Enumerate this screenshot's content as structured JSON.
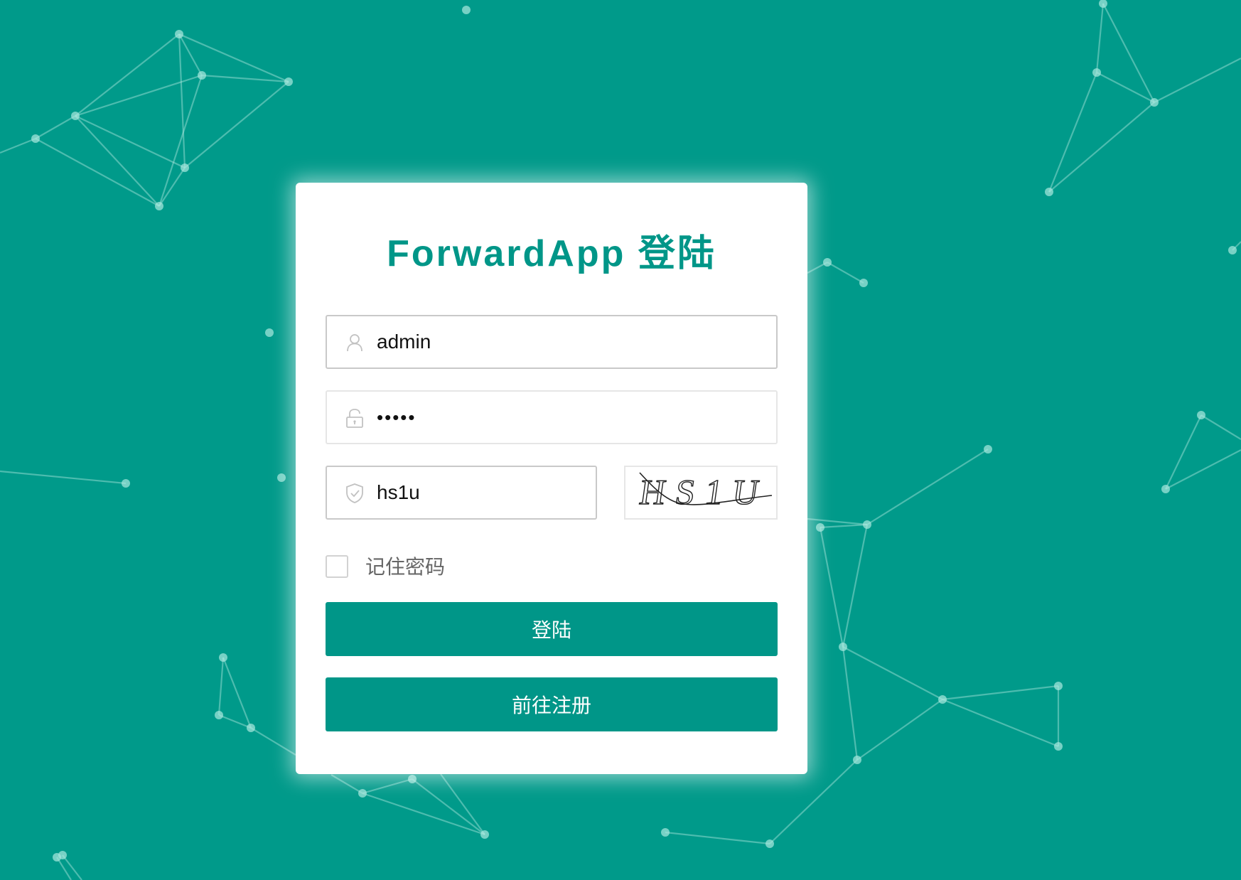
{
  "card": {
    "title": "ForwardApp 登陆"
  },
  "form": {
    "username": {
      "value": "admin",
      "icon": "user-icon"
    },
    "password": {
      "value": "•••••",
      "icon": "lock-icon"
    },
    "captcha": {
      "value": "hs1u",
      "icon": "shield-check-icon",
      "image_text": "HS1U"
    },
    "remember_label": "记住密码",
    "remember_checked": false
  },
  "buttons": {
    "login_label": "登陆",
    "register_label": "前往注册"
  },
  "colors": {
    "background": "#009a8a",
    "accent": "#009688",
    "card": "#ffffff"
  }
}
